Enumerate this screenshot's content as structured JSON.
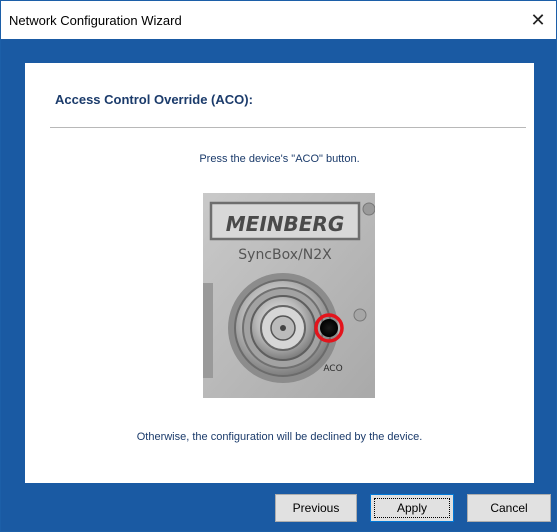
{
  "window": {
    "title": "Network Configuration Wizard",
    "close_label": "✕"
  },
  "content": {
    "heading": "Access Control Override (ACO):",
    "instruction": "Press the device's \"ACO\" button.",
    "footer": "Otherwise, the configuration will be declined by the device.",
    "image": {
      "brand": "MEINBERG",
      "model": "SyncBox/N2X",
      "button_label": "ACO"
    }
  },
  "buttons": {
    "previous": "Previous",
    "apply": "Apply",
    "cancel": "Cancel"
  },
  "colors": {
    "frame": "#1a5aa3",
    "heading_text": "#1b3b6b",
    "aco_ring": "#e3141c"
  }
}
